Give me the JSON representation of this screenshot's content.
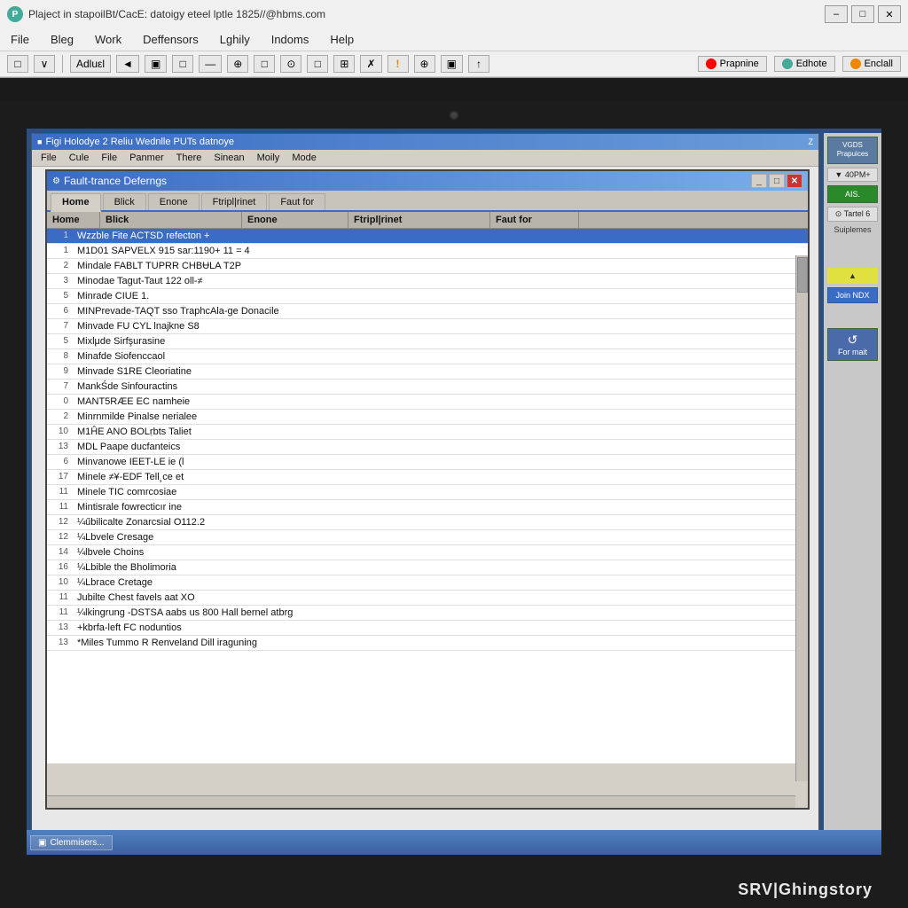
{
  "outer": {
    "title": "Plaject in stapoilBt/CacE: datoigy eteel lptle 1825//@hbms.com",
    "icon_label": "P",
    "min_btn": "–",
    "max_btn": "□",
    "close_btn": "✕"
  },
  "menu": {
    "items": [
      "File",
      "Bleg",
      "Work",
      "Deffensors",
      "Lghily",
      "Indoms",
      "Help"
    ]
  },
  "toolbar": {
    "buttons": [
      "□",
      "∨",
      "Adluεl",
      "◄",
      "▣",
      "□",
      "—",
      "⊕",
      "□",
      "⊙",
      "□",
      "⊞",
      "✗",
      "!",
      "⊕",
      "▣",
      "↑"
    ],
    "right_btns": [
      "Prapnine",
      "Edhote",
      "Enclall"
    ]
  },
  "app_window": {
    "title": "Figi Holodye 2 Reliu Wednlle PUTs datnoye",
    "menu": [
      "File",
      "Cule",
      "File",
      "Panmer",
      "There",
      "Sinean",
      "Moily",
      "Mode"
    ]
  },
  "dialog": {
    "title": "Fault-trance Deferngs",
    "tabs": [
      "Home",
      "Blick",
      "Enone",
      "Ftripl|rinet",
      "Faut for"
    ],
    "active_tab": "Home",
    "columns": [
      "Home",
      "Blick",
      "Enone",
      "Ftripl|rinet",
      "Faut for"
    ],
    "rows": [
      {
        "num": "1",
        "desc": "Wzzble Fite ACTSD refecton +",
        "selected": true
      },
      {
        "num": "1",
        "desc": "M1D01 SAPVELX 915 sar:1190+ 11 = 4"
      },
      {
        "num": "2",
        "desc": "Mindale FABLT TUPRR CHBɄLA T2P"
      },
      {
        "num": "3",
        "desc": "Minodae Tagut-Taut 122 oll-≠"
      },
      {
        "num": "5",
        "desc": "Minrade CIUE 1."
      },
      {
        "num": "6",
        "desc": "MINPrevade-TAQT sso TraphcAla-ge Donacile"
      },
      {
        "num": "7",
        "desc": "Minvade FU CYL lnajkne S8"
      },
      {
        "num": "5",
        "desc": "Mixlμde Sirfşurasine"
      },
      {
        "num": "8",
        "desc": "Minafde Siofenccaol"
      },
      {
        "num": "9",
        "desc": "Minvade S1RE Cleoriatine"
      },
      {
        "num": "7",
        "desc": "MankŚde Sinfouractins"
      },
      {
        "num": "0",
        "desc": "MANT5RÆE EC namheie"
      },
      {
        "num": "2",
        "desc": "Minrnmilde Pinalse nerialee"
      },
      {
        "num": "10",
        "desc": "M1ĤE ANO BOLṛbts Taliet"
      },
      {
        "num": "13",
        "desc": "MDL Paape ducfanteics"
      },
      {
        "num": "6",
        "desc": "Minvanowe IEET-LE ie (l"
      },
      {
        "num": "17",
        "desc": "Minele ≠¥-EDF Tell¸ce et"
      },
      {
        "num": "11",
        "desc": "Minele TIC comrcosiae"
      },
      {
        "num": "11",
        "desc": "Mintisrale fowrecticır ine"
      },
      {
        "num": "12",
        "desc": "¼űbilicalte Zonarcsial O112.2"
      },
      {
        "num": "12",
        "desc": "¼Lbvele Cresage"
      },
      {
        "num": "14",
        "desc": "¼lbvele Choins"
      },
      {
        "num": "16",
        "desc": "¼Lbible the Bholimoria"
      },
      {
        "num": "10",
        "desc": "¼Lbrace Cretage"
      },
      {
        "num": "11",
        "desc": "Jubilte Chest favels aat XO"
      },
      {
        "num": "11",
        "desc": "¼lkingrung -DSTSA aabs us 800 Hall bernel atbrg"
      },
      {
        "num": "13",
        "desc": "+kbrfa-left FC noduntios"
      },
      {
        "num": "13",
        "desc": "*Miles Tummo R Renveland Dill iraguning"
      }
    ]
  },
  "right_panel": {
    "vgds_label": "VGDS Prapuices",
    "time_label": "40PM+",
    "ais_label": "AIS.",
    "tartel_label": "Tartel 6",
    "suiplemes_label": "Suiplemes",
    "warning_icon": "▲",
    "join_ndx_label": "Join NDX",
    "for_mait_label": "For mait"
  },
  "taskbar": {
    "items": [
      "Clemmisers..."
    ]
  },
  "brand": "SRV|Ghingstory"
}
